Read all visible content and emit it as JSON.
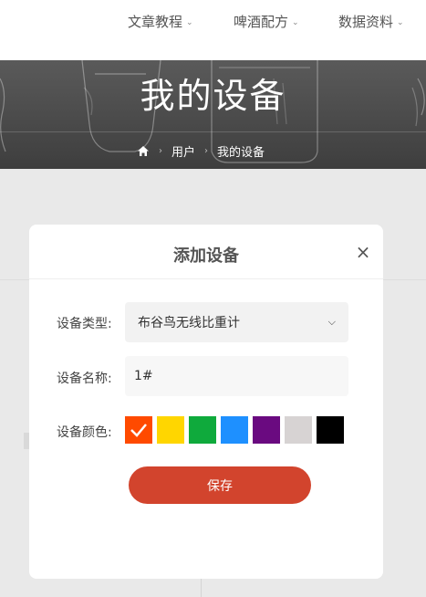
{
  "nav": {
    "items": [
      {
        "label": "文章教程"
      },
      {
        "label": "啤酒配方"
      },
      {
        "label": "数据资料"
      }
    ],
    "chevron_icon": "chevron-down-icon"
  },
  "hero": {
    "title": "我的设备",
    "breadcrumb": {
      "home_icon": "home-icon",
      "items": [
        "用户",
        "我的设备"
      ],
      "separator": "›"
    }
  },
  "modal": {
    "title": "添加设备",
    "close_label": "×",
    "device_type": {
      "label": "设备类型:",
      "selected": "布谷鸟无线比重计"
    },
    "device_name": {
      "label": "设备名称:",
      "value": "1#"
    },
    "device_color": {
      "label": "设备颜色:",
      "options": [
        "#ff4a00",
        "#ffd600",
        "#0faa3c",
        "#1e90ff",
        "#6a0a80",
        "#d7d3d3",
        "#000000"
      ],
      "selected_index": 0
    },
    "save_label": "保存",
    "save_color": "#d2442d"
  }
}
